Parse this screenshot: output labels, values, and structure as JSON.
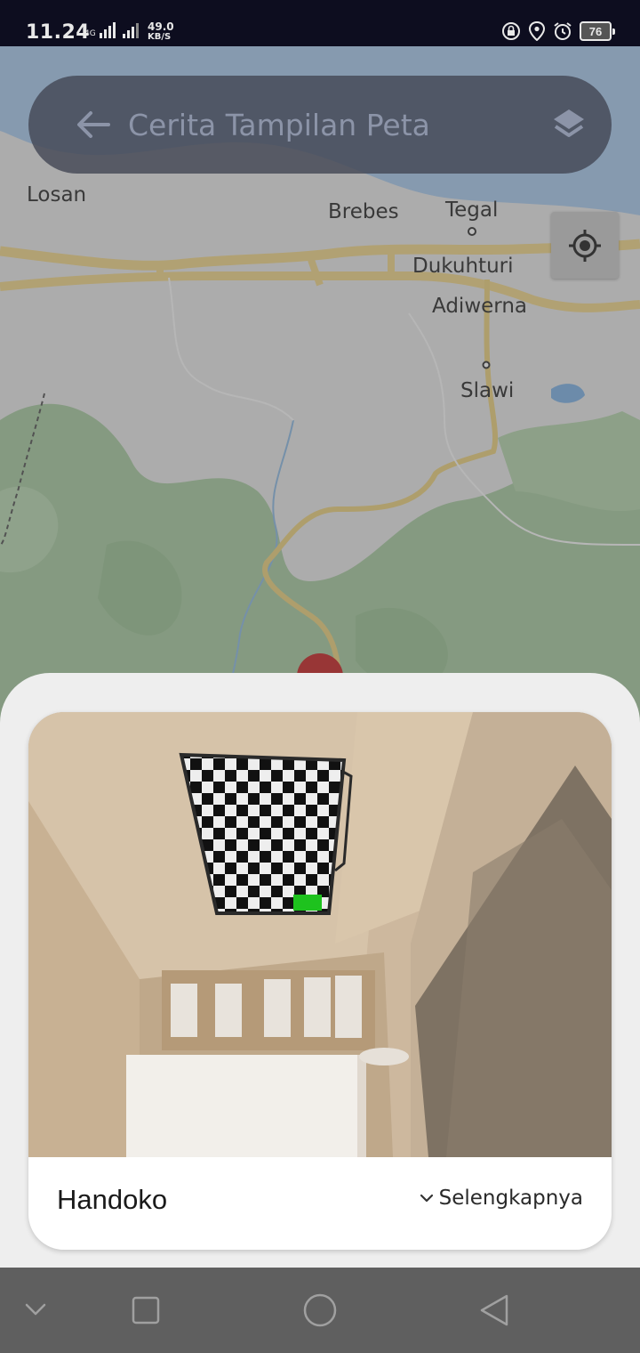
{
  "status_bar": {
    "time": "11.24",
    "network_type": "4G",
    "speed_value": "49.0",
    "speed_unit": "KB/S",
    "battery": "76",
    "icons": [
      "lock-rotation-icon",
      "location-icon",
      "alarm-icon",
      "battery-icon"
    ]
  },
  "search": {
    "placeholder": "Cerita Tampilan Peta",
    "back_icon": "arrow-left-icon",
    "layers_icon": "layers-icon"
  },
  "map": {
    "places": [
      "Losan",
      "Brebes",
      "Tegal",
      "Dukuhturi",
      "Adiwerna",
      "Slawi"
    ],
    "locate_icon": "my-location-icon",
    "colors": {
      "land": "#e3e3e3",
      "forest": "#a8c7a0",
      "road": "#f3d27a",
      "water": "#9fc3e8",
      "marker": "#c62828"
    }
  },
  "card": {
    "name": "Handoko",
    "more_label": "Selengkapnya",
    "more_icon": "chevron-down-icon"
  },
  "nav_bar": {
    "buttons": [
      "hide-keyboard-icon",
      "recents-icon",
      "home-icon",
      "back-icon"
    ]
  }
}
